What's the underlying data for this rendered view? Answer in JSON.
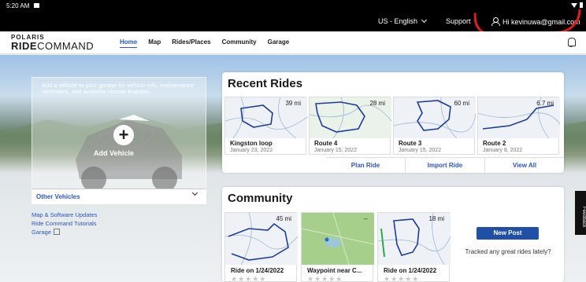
{
  "status": {
    "time": "5:20 AM"
  },
  "topbar": {
    "language": "US - English",
    "support": "Support",
    "account": "Hi kevinuwa@gmail.com"
  },
  "nav": {
    "logo_top": "POLARIS",
    "logo_bold": "RIDE",
    "logo_thin": "COMMAND",
    "links": [
      "Home",
      "Map",
      "Rides/Places",
      "Community",
      "Garage"
    ]
  },
  "vehicle": {
    "prompt": "Add a vehicle to your garage for vehicle info, maintenance reminders, and available remote features.",
    "add_label": "Add Vehicle",
    "other_label": "Other Vehicles"
  },
  "links": [
    "Map & Software Updates",
    "Ride Command Tutorials",
    "Garage"
  ],
  "recent": {
    "title": "Recent Rides",
    "rides": [
      {
        "name": "Kingston loop",
        "date": "January 23, 2022",
        "distance": "39 mi"
      },
      {
        "name": "Route 4",
        "date": "January 15, 2022",
        "distance": "28 mi"
      },
      {
        "name": "Route 3",
        "date": "January 15, 2022",
        "distance": "60 mi"
      },
      {
        "name": "Route 2",
        "date": "January 8, 2022",
        "distance": "6.7 mi"
      }
    ],
    "actions": [
      "Plan Ride",
      "Import Ride",
      "View All"
    ]
  },
  "community": {
    "title": "Community",
    "posts": [
      {
        "name": "Ride on 1/24/2022",
        "distance": "45 mi"
      },
      {
        "name": "Waypoint near C...",
        "distance": "--"
      },
      {
        "name": "Ride on 1/24/2022",
        "distance": "18 mi"
      }
    ],
    "new_post": "New Post",
    "tracked": "Tracked any great rides lately?",
    "stars": "★★★★★"
  },
  "feedback": "Feedback",
  "colors": {
    "accent": "#2b55c8",
    "button": "#1f4fa6",
    "annotation": "#e31b1b"
  }
}
